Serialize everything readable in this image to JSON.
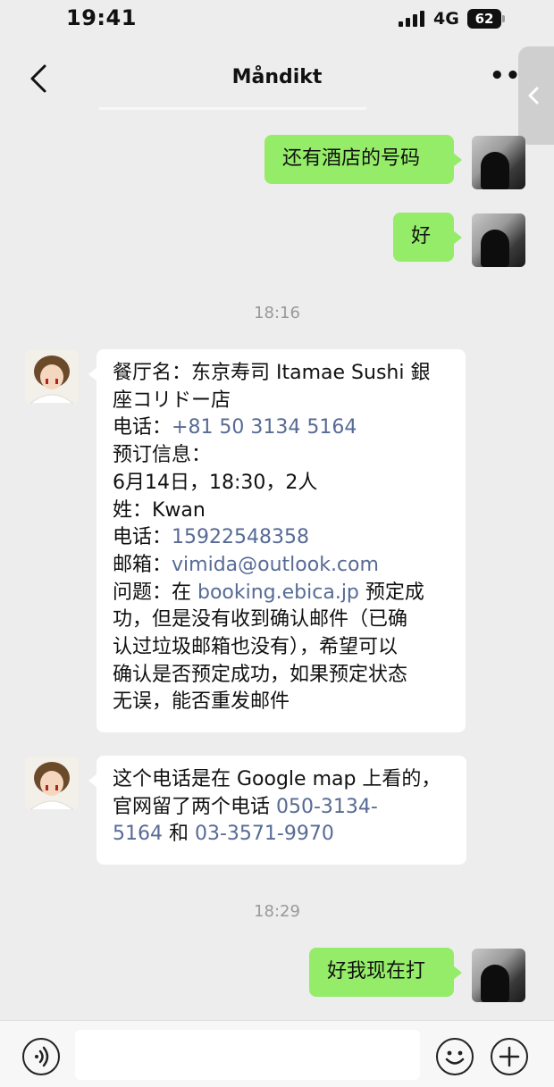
{
  "status_bar": {
    "time": "19:41",
    "network": "4G",
    "battery": "62"
  },
  "nav": {
    "title": "Måndikt"
  },
  "messages": {
    "m1": "还有酒店的号码",
    "m2": "好",
    "ts1": "18:16",
    "m3": {
      "l1": "餐厅名：东京寿司 Itamae Sushi 銀",
      "l2": "座コリドー店",
      "l3_label": "电话：",
      "l3_link": "+81 50 3134 5164",
      "l4": "预订信息：",
      "l5": "6月14日，18:30，2人",
      "l6": "姓：Kwan",
      "l7_label": "电话：",
      "l7_link": "15922548358",
      "l8_label": "邮箱：",
      "l8_link": "vimida@outlook.com",
      "l9_pre": "问题：在 ",
      "l9_link": "booking.ebica.jp",
      "l9_post": " 预定成",
      "l10": "功，但是没有收到确认邮件（已确",
      "l11": "认过垃圾邮箱也没有），希望可以",
      "l12": "确认是否预定成功，如果预定状态",
      "l13": "无误，能否重发邮件"
    },
    "m4": {
      "l1": "这个电话是在 Google map 上看的，",
      "l2_pre": "官网留了两个电话 ",
      "l2_link": "050-3134-",
      "l3_link": "5164",
      "l3_mid": " 和 ",
      "l3_link2": "03-3571-9970"
    },
    "ts2": "18:29",
    "m5": "好我现在打"
  },
  "icons": {
    "back": "chevron-left-icon",
    "more": "more-dots-icon",
    "voice": "voice-icon",
    "emoji": "emoji-icon",
    "plus": "plus-icon"
  },
  "colors": {
    "outgoing": "#95ec69",
    "incoming": "#ffffff",
    "link": "#576b95",
    "background": "#ededed"
  }
}
